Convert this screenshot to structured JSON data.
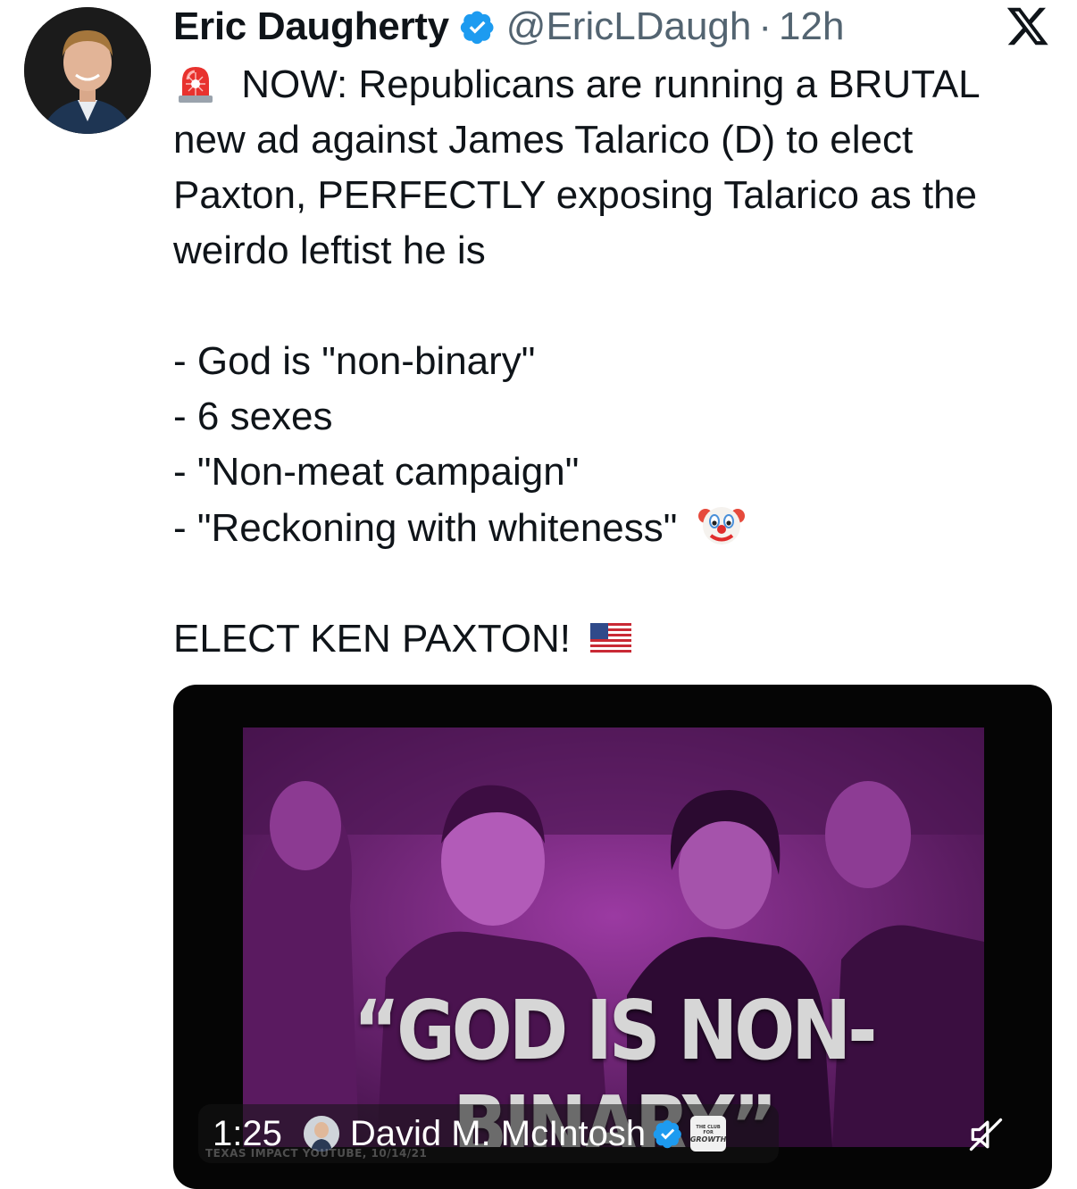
{
  "author": {
    "display_name": "Eric Daugherty",
    "handle": "@EricLDaugh",
    "separator": "·",
    "time": "12h",
    "verified": true
  },
  "tweet": {
    "line_1": "NOW: Republicans are running a BRUTAL",
    "line_2": "new ad against James Talarico (D) to elect",
    "line_3": "Paxton, PERFECTLY exposing Talarico as the",
    "line_4": "weirdo leftist he is",
    "bullets": [
      "- God is \"non-binary\"",
      "- 6 sexes",
      "- \"Non-meat campaign\"",
      "- \"Reckoning with whiteness\""
    ],
    "closing": "ELECT KEN PAXTON!"
  },
  "media": {
    "caption": "“GOD IS NON-BINARY”",
    "duration": "1:25",
    "account_name": "David M. McIntosh",
    "org_badge_line_1": "THE CLUB FOR",
    "org_badge_line_2": "GROWTH",
    "watermark": "TEXAS IMPACT YOUTUBE, 10/14/21"
  },
  "icons": {
    "verified": "verified-badge-icon",
    "x_logo": "x-logo-icon",
    "siren": "police-siren-emoji",
    "clown": "clown-face-emoji",
    "flag": "us-flag-emoji",
    "mute": "muted-speaker-icon"
  },
  "colors": {
    "text": "#0f1419",
    "secondary": "#536471",
    "verified": "#1d9bf0",
    "media_tint": "#6e1f74",
    "media_background": "#050505"
  }
}
